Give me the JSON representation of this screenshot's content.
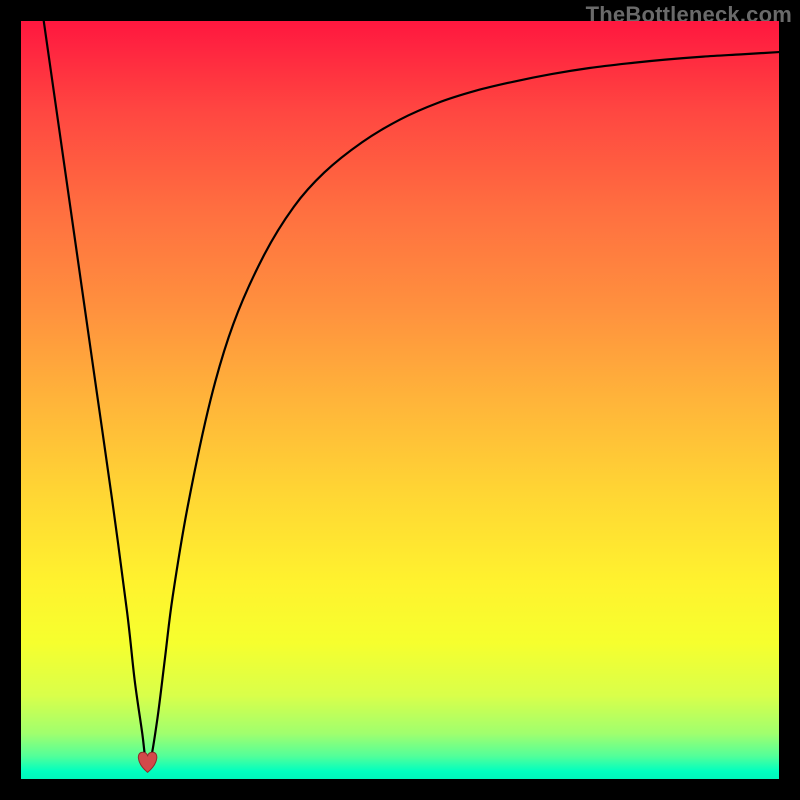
{
  "attribution": "TheBottleneck.com",
  "chart_data": {
    "type": "line",
    "title": "",
    "xlabel": "",
    "ylabel": "",
    "xlim": [
      0,
      100
    ],
    "ylim": [
      0,
      100
    ],
    "series": [
      {
        "name": "curve",
        "x": [
          3,
          5,
          8,
          10,
          12,
          14,
          15,
          16,
          16.5,
          17,
          18,
          19,
          20,
          22,
          25,
          28,
          32,
          36,
          40,
          45,
          50,
          55,
          60,
          65,
          70,
          75,
          80,
          85,
          90,
          95,
          100
        ],
        "y": [
          100,
          86,
          65,
          51,
          37,
          22,
          13,
          6,
          2,
          2,
          8,
          16,
          24,
          36,
          50,
          60,
          69,
          75.5,
          80,
          84,
          87,
          89.2,
          90.8,
          92,
          93,
          93.8,
          94.4,
          94.9,
          95.3,
          95.6,
          95.9
        ]
      }
    ],
    "marker": {
      "x": 16.7,
      "y": 1.8,
      "shape": "heart"
    },
    "gradient_stops": [
      {
        "pos": 0.0,
        "color": "#ff173f"
      },
      {
        "pos": 0.12,
        "color": "#ff4741"
      },
      {
        "pos": 0.25,
        "color": "#ff6f40"
      },
      {
        "pos": 0.38,
        "color": "#ff913e"
      },
      {
        "pos": 0.5,
        "color": "#ffb43a"
      },
      {
        "pos": 0.62,
        "color": "#ffd534"
      },
      {
        "pos": 0.74,
        "color": "#fff22e"
      },
      {
        "pos": 0.82,
        "color": "#f6ff2e"
      },
      {
        "pos": 0.89,
        "color": "#d9ff4a"
      },
      {
        "pos": 0.94,
        "color": "#a0ff6e"
      },
      {
        "pos": 0.97,
        "color": "#52ff9a"
      },
      {
        "pos": 0.99,
        "color": "#00ffc0"
      },
      {
        "pos": 1.0,
        "color": "#00f6bb"
      }
    ]
  }
}
